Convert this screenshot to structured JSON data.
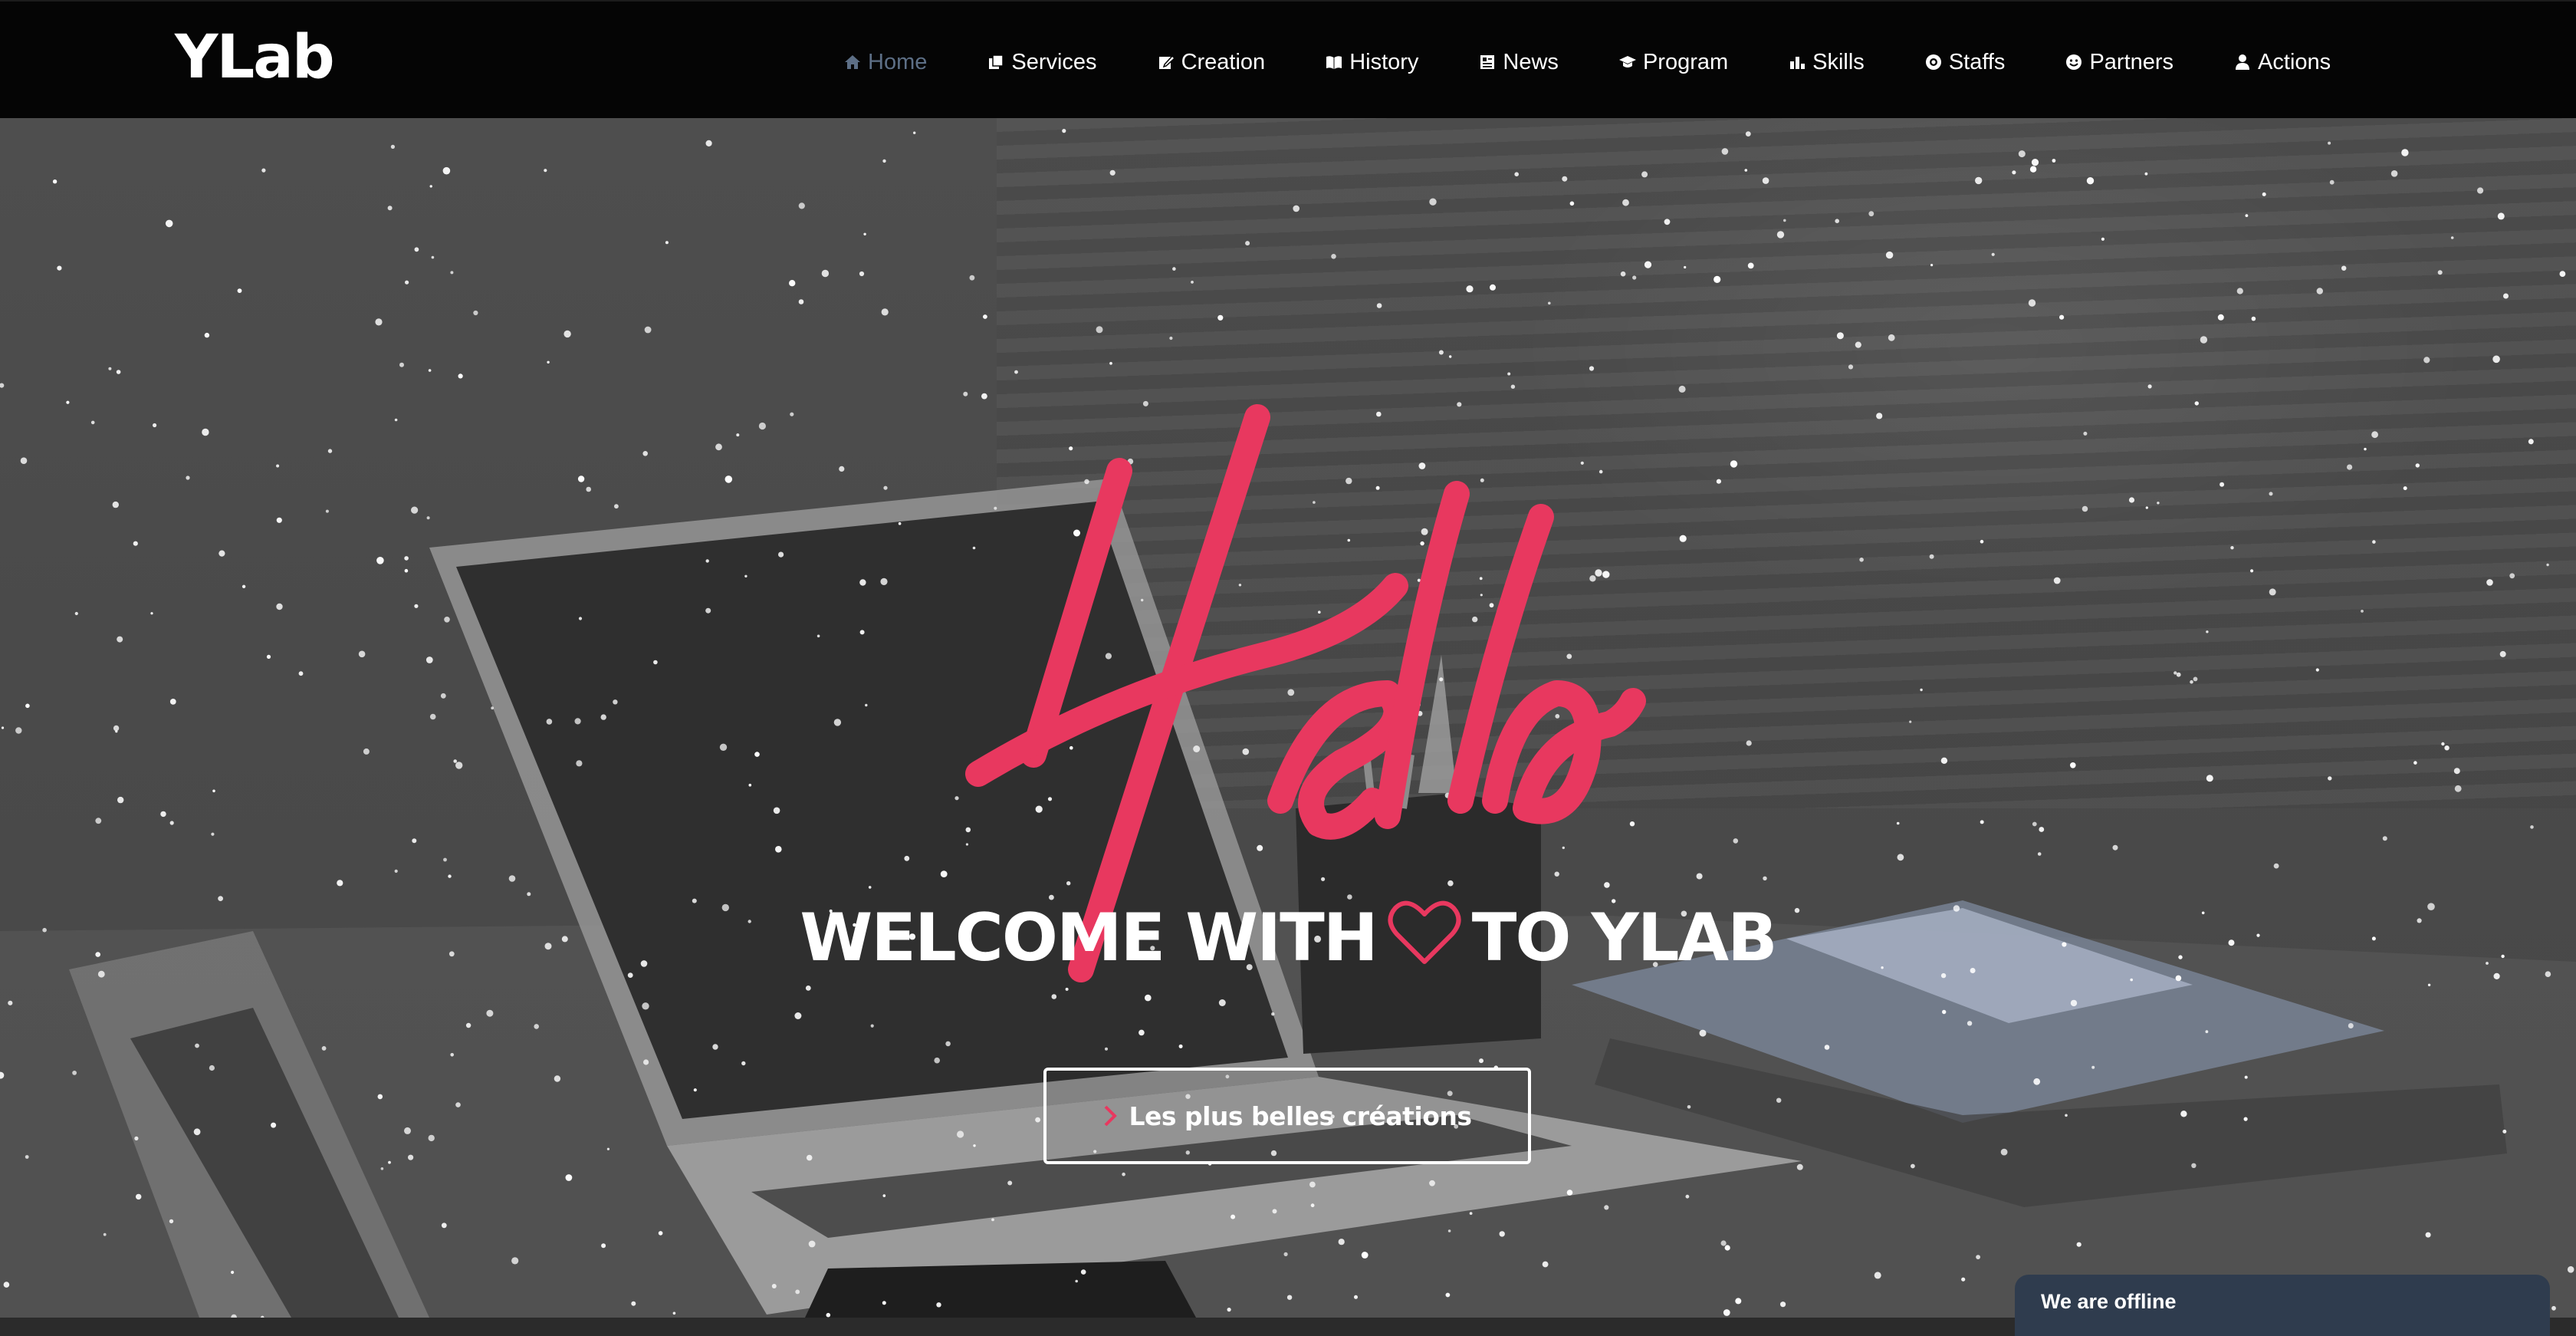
{
  "brand": {
    "logo": "YLab"
  },
  "nav": {
    "items": [
      {
        "label": "Home",
        "icon": "home-icon",
        "active": true
      },
      {
        "label": "Services",
        "icon": "copy-icon"
      },
      {
        "label": "Creation",
        "icon": "edit-icon"
      },
      {
        "label": "History",
        "icon": "book-icon"
      },
      {
        "label": "News",
        "icon": "newspaper-icon"
      },
      {
        "label": "Program",
        "icon": "graduation-cap-icon"
      },
      {
        "label": "Skills",
        "icon": "bar-chart-icon"
      },
      {
        "label": "Staffs",
        "icon": "support-icon"
      },
      {
        "label": "Partners",
        "icon": "smile-icon"
      },
      {
        "label": "Actions",
        "icon": "user-icon"
      }
    ],
    "active_color": "#5d6f86"
  },
  "hero": {
    "script_text": "Hello",
    "welcome_before": "WELCOME WITH",
    "welcome_after": "TO YLAB",
    "heart_icon": "heart-outline-icon",
    "cta_label": "Les plus belles créations",
    "accent_color": "#e8385f"
  },
  "chat": {
    "status": "We are offline",
    "bg_color": "#2f3c4e"
  }
}
